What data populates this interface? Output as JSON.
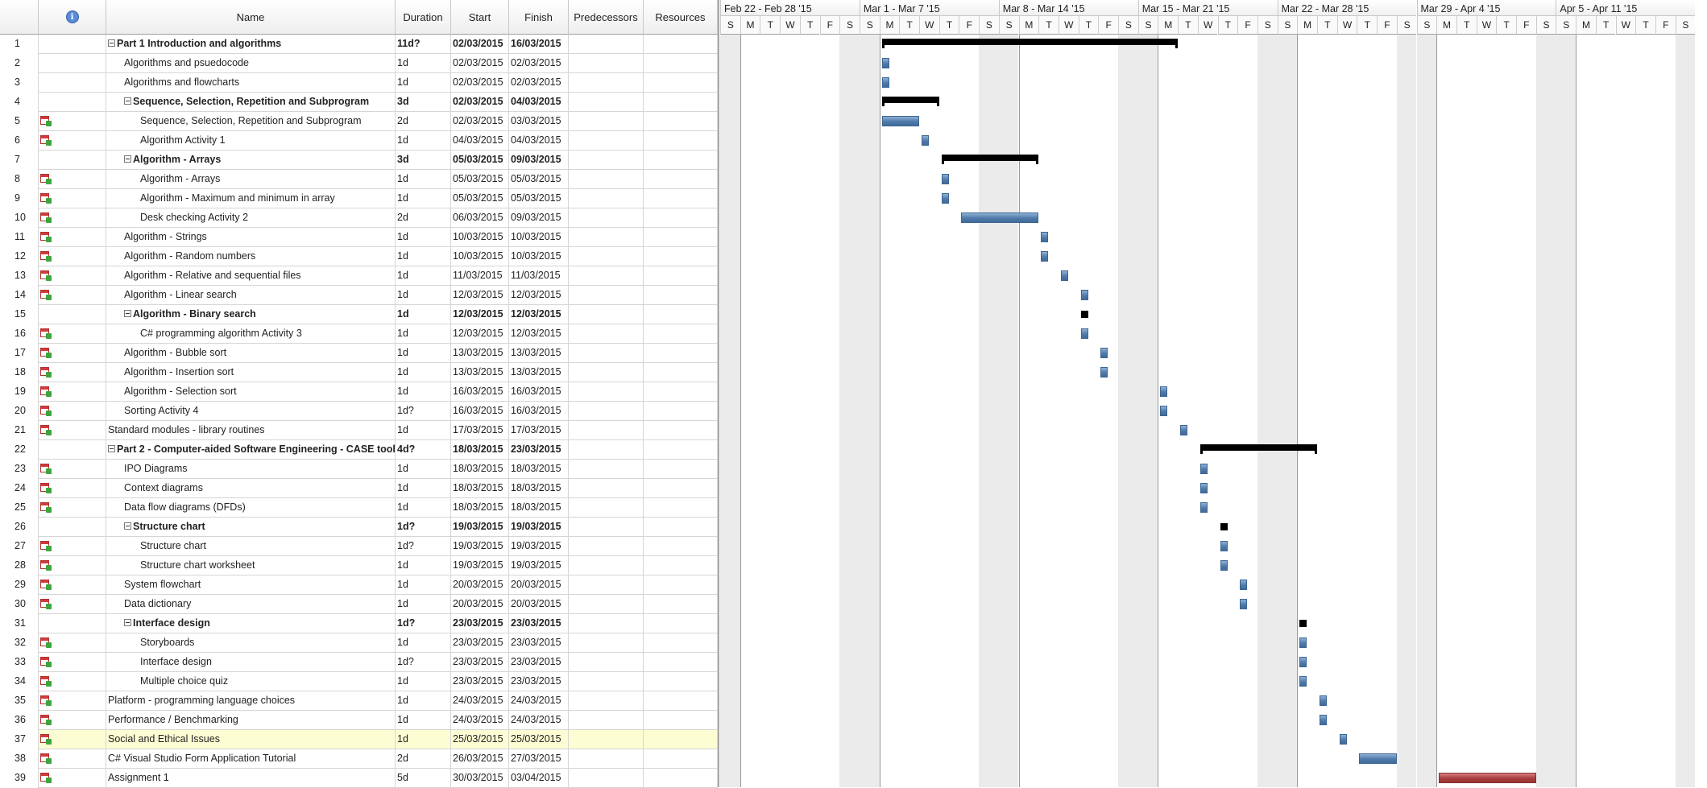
{
  "grid": {
    "headers": {
      "info": "i",
      "name": "Name",
      "duration": "Duration",
      "start": "Start",
      "finish": "Finish",
      "predecessors": "Predecessors",
      "resources": "Resources"
    },
    "rows": [
      {
        "n": "1",
        "name": "Part 1 Introduction and algorithms",
        "dur": "11d?",
        "start": "02/03/2015",
        "fin": "16/03/2015",
        "lvl": 0,
        "sum": true,
        "icon": false
      },
      {
        "n": "2",
        "name": "Algorithms and psuedocode",
        "dur": "1d",
        "start": "02/03/2015",
        "fin": "02/03/2015",
        "lvl": 1,
        "sum": false,
        "icon": false
      },
      {
        "n": "3",
        "name": "Algorithms and flowcharts",
        "dur": "1d",
        "start": "02/03/2015",
        "fin": "02/03/2015",
        "lvl": 1,
        "sum": false,
        "icon": false
      },
      {
        "n": "4",
        "name": "Sequence, Selection, Repetition and Subprogram",
        "dur": "3d",
        "start": "02/03/2015",
        "fin": "04/03/2015",
        "lvl": 1,
        "sum": true,
        "icon": false
      },
      {
        "n": "5",
        "name": "Sequence, Selection, Repetition and Subprogram",
        "dur": "2d",
        "start": "02/03/2015",
        "fin": "03/03/2015",
        "lvl": 2,
        "sum": false,
        "icon": true
      },
      {
        "n": "6",
        "name": "Algorithm Activity 1",
        "dur": "1d",
        "start": "04/03/2015",
        "fin": "04/03/2015",
        "lvl": 2,
        "sum": false,
        "icon": true
      },
      {
        "n": "7",
        "name": "Algorithm - Arrays",
        "dur": "3d",
        "start": "05/03/2015",
        "fin": "09/03/2015",
        "lvl": 1,
        "sum": true,
        "icon": false
      },
      {
        "n": "8",
        "name": "Algorithm - Arrays",
        "dur": "1d",
        "start": "05/03/2015",
        "fin": "05/03/2015",
        "lvl": 2,
        "sum": false,
        "icon": true
      },
      {
        "n": "9",
        "name": "Algorithm - Maximum and minimum in array",
        "dur": "1d",
        "start": "05/03/2015",
        "fin": "05/03/2015",
        "lvl": 2,
        "sum": false,
        "icon": true
      },
      {
        "n": "10",
        "name": "Desk checking Activity 2",
        "dur": "2d",
        "start": "06/03/2015",
        "fin": "09/03/2015",
        "lvl": 2,
        "sum": false,
        "icon": true
      },
      {
        "n": "11",
        "name": "Algorithm - Strings",
        "dur": "1d",
        "start": "10/03/2015",
        "fin": "10/03/2015",
        "lvl": 1,
        "sum": false,
        "icon": true
      },
      {
        "n": "12",
        "name": "Algorithm - Random numbers",
        "dur": "1d",
        "start": "10/03/2015",
        "fin": "10/03/2015",
        "lvl": 1,
        "sum": false,
        "icon": true
      },
      {
        "n": "13",
        "name": "Algorithm - Relative and sequential files",
        "dur": "1d",
        "start": "11/03/2015",
        "fin": "11/03/2015",
        "lvl": 1,
        "sum": false,
        "icon": true
      },
      {
        "n": "14",
        "name": "Algorithm - Linear search",
        "dur": "1d",
        "start": "12/03/2015",
        "fin": "12/03/2015",
        "lvl": 1,
        "sum": false,
        "icon": true
      },
      {
        "n": "15",
        "name": "Algorithm - Binary search",
        "dur": "1d",
        "start": "12/03/2015",
        "fin": "12/03/2015",
        "lvl": 1,
        "sum": true,
        "icon": false
      },
      {
        "n": "16",
        "name": "C# programming algorithm Activity 3",
        "dur": "1d",
        "start": "12/03/2015",
        "fin": "12/03/2015",
        "lvl": 2,
        "sum": false,
        "icon": true
      },
      {
        "n": "17",
        "name": "Algorithm - Bubble sort",
        "dur": "1d",
        "start": "13/03/2015",
        "fin": "13/03/2015",
        "lvl": 1,
        "sum": false,
        "icon": true
      },
      {
        "n": "18",
        "name": "Algorithm - Insertion sort",
        "dur": "1d",
        "start": "13/03/2015",
        "fin": "13/03/2015",
        "lvl": 1,
        "sum": false,
        "icon": true
      },
      {
        "n": "19",
        "name": "Algorithm - Selection sort",
        "dur": "1d",
        "start": "16/03/2015",
        "fin": "16/03/2015",
        "lvl": 1,
        "sum": false,
        "icon": true
      },
      {
        "n": "20",
        "name": "Sorting Activity 4",
        "dur": "1d?",
        "start": "16/03/2015",
        "fin": "16/03/2015",
        "lvl": 1,
        "sum": false,
        "icon": true
      },
      {
        "n": "21",
        "name": "Standard modules - library routines",
        "dur": "1d",
        "start": "17/03/2015",
        "fin": "17/03/2015",
        "lvl": 0,
        "sum": false,
        "icon": true
      },
      {
        "n": "22",
        "name": "Part 2 - Computer-aided Software Engineering - CASE tools",
        "dur": "4d?",
        "start": "18/03/2015",
        "fin": "23/03/2015",
        "lvl": 0,
        "sum": true,
        "icon": false
      },
      {
        "n": "23",
        "name": "IPO Diagrams",
        "dur": "1d",
        "start": "18/03/2015",
        "fin": "18/03/2015",
        "lvl": 1,
        "sum": false,
        "icon": true
      },
      {
        "n": "24",
        "name": "Context diagrams",
        "dur": "1d",
        "start": "18/03/2015",
        "fin": "18/03/2015",
        "lvl": 1,
        "sum": false,
        "icon": true
      },
      {
        "n": "25",
        "name": "Data flow diagrams (DFDs)",
        "dur": "1d",
        "start": "18/03/2015",
        "fin": "18/03/2015",
        "lvl": 1,
        "sum": false,
        "icon": true
      },
      {
        "n": "26",
        "name": "Structure chart",
        "dur": "1d?",
        "start": "19/03/2015",
        "fin": "19/03/2015",
        "lvl": 1,
        "sum": true,
        "icon": false
      },
      {
        "n": "27",
        "name": "Structure chart",
        "dur": "1d?",
        "start": "19/03/2015",
        "fin": "19/03/2015",
        "lvl": 2,
        "sum": false,
        "icon": true
      },
      {
        "n": "28",
        "name": "Structure chart worksheet",
        "dur": "1d",
        "start": "19/03/2015",
        "fin": "19/03/2015",
        "lvl": 2,
        "sum": false,
        "icon": true
      },
      {
        "n": "29",
        "name": "System flowchart",
        "dur": "1d",
        "start": "20/03/2015",
        "fin": "20/03/2015",
        "lvl": 1,
        "sum": false,
        "icon": true
      },
      {
        "n": "30",
        "name": "Data dictionary",
        "dur": "1d",
        "start": "20/03/2015",
        "fin": "20/03/2015",
        "lvl": 1,
        "sum": false,
        "icon": true
      },
      {
        "n": "31",
        "name": "Interface design",
        "dur": "1d?",
        "start": "23/03/2015",
        "fin": "23/03/2015",
        "lvl": 1,
        "sum": true,
        "icon": false
      },
      {
        "n": "32",
        "name": "Storyboards",
        "dur": "1d",
        "start": "23/03/2015",
        "fin": "23/03/2015",
        "lvl": 2,
        "sum": false,
        "icon": true
      },
      {
        "n": "33",
        "name": "Interface design",
        "dur": "1d?",
        "start": "23/03/2015",
        "fin": "23/03/2015",
        "lvl": 2,
        "sum": false,
        "icon": true
      },
      {
        "n": "34",
        "name": "Multiple choice quiz",
        "dur": "1d",
        "start": "23/03/2015",
        "fin": "23/03/2015",
        "lvl": 2,
        "sum": false,
        "icon": true
      },
      {
        "n": "35",
        "name": "Platform - programming language choices",
        "dur": "1d",
        "start": "24/03/2015",
        "fin": "24/03/2015",
        "lvl": 0,
        "sum": false,
        "icon": true
      },
      {
        "n": "36",
        "name": "Performance / Benchmarking",
        "dur": "1d",
        "start": "24/03/2015",
        "fin": "24/03/2015",
        "lvl": 0,
        "sum": false,
        "icon": true
      },
      {
        "n": "37",
        "name": "Social and Ethical Issues",
        "dur": "1d",
        "start": "25/03/2015",
        "fin": "25/03/2015",
        "lvl": 0,
        "sum": false,
        "icon": true,
        "selected": true
      },
      {
        "n": "38",
        "name": "C# Visual Studio Form Application Tutorial",
        "dur": "2d",
        "start": "26/03/2015",
        "fin": "27/03/2015",
        "lvl": 0,
        "sum": false,
        "icon": true
      },
      {
        "n": "39",
        "name": "Assignment 1",
        "dur": "5d",
        "start": "30/03/2015",
        "fin": "03/04/2015",
        "lvl": 0,
        "sum": false,
        "icon": true
      }
    ]
  },
  "gantt": {
    "weeks": [
      "Feb 22 - Feb 28 '15",
      "Mar 1 - Mar 7 '15",
      "Mar 8 - Mar 14 '15",
      "Mar 15 - Mar 21 '15",
      "Mar 22 - Mar 28 '15",
      "Mar 29 - Apr 4 '15",
      "Apr 5 - Apr 11 '15"
    ],
    "day_letters": [
      "S",
      "M",
      "T",
      "W",
      "T",
      "F",
      "S"
    ],
    "colors": {
      "task_bar": "#4f7aaa",
      "summary_bar": "#000000",
      "critical_bar": "#a83d3d",
      "selected_row": "#fdfdd4",
      "weekend": "#ebebeb"
    }
  }
}
